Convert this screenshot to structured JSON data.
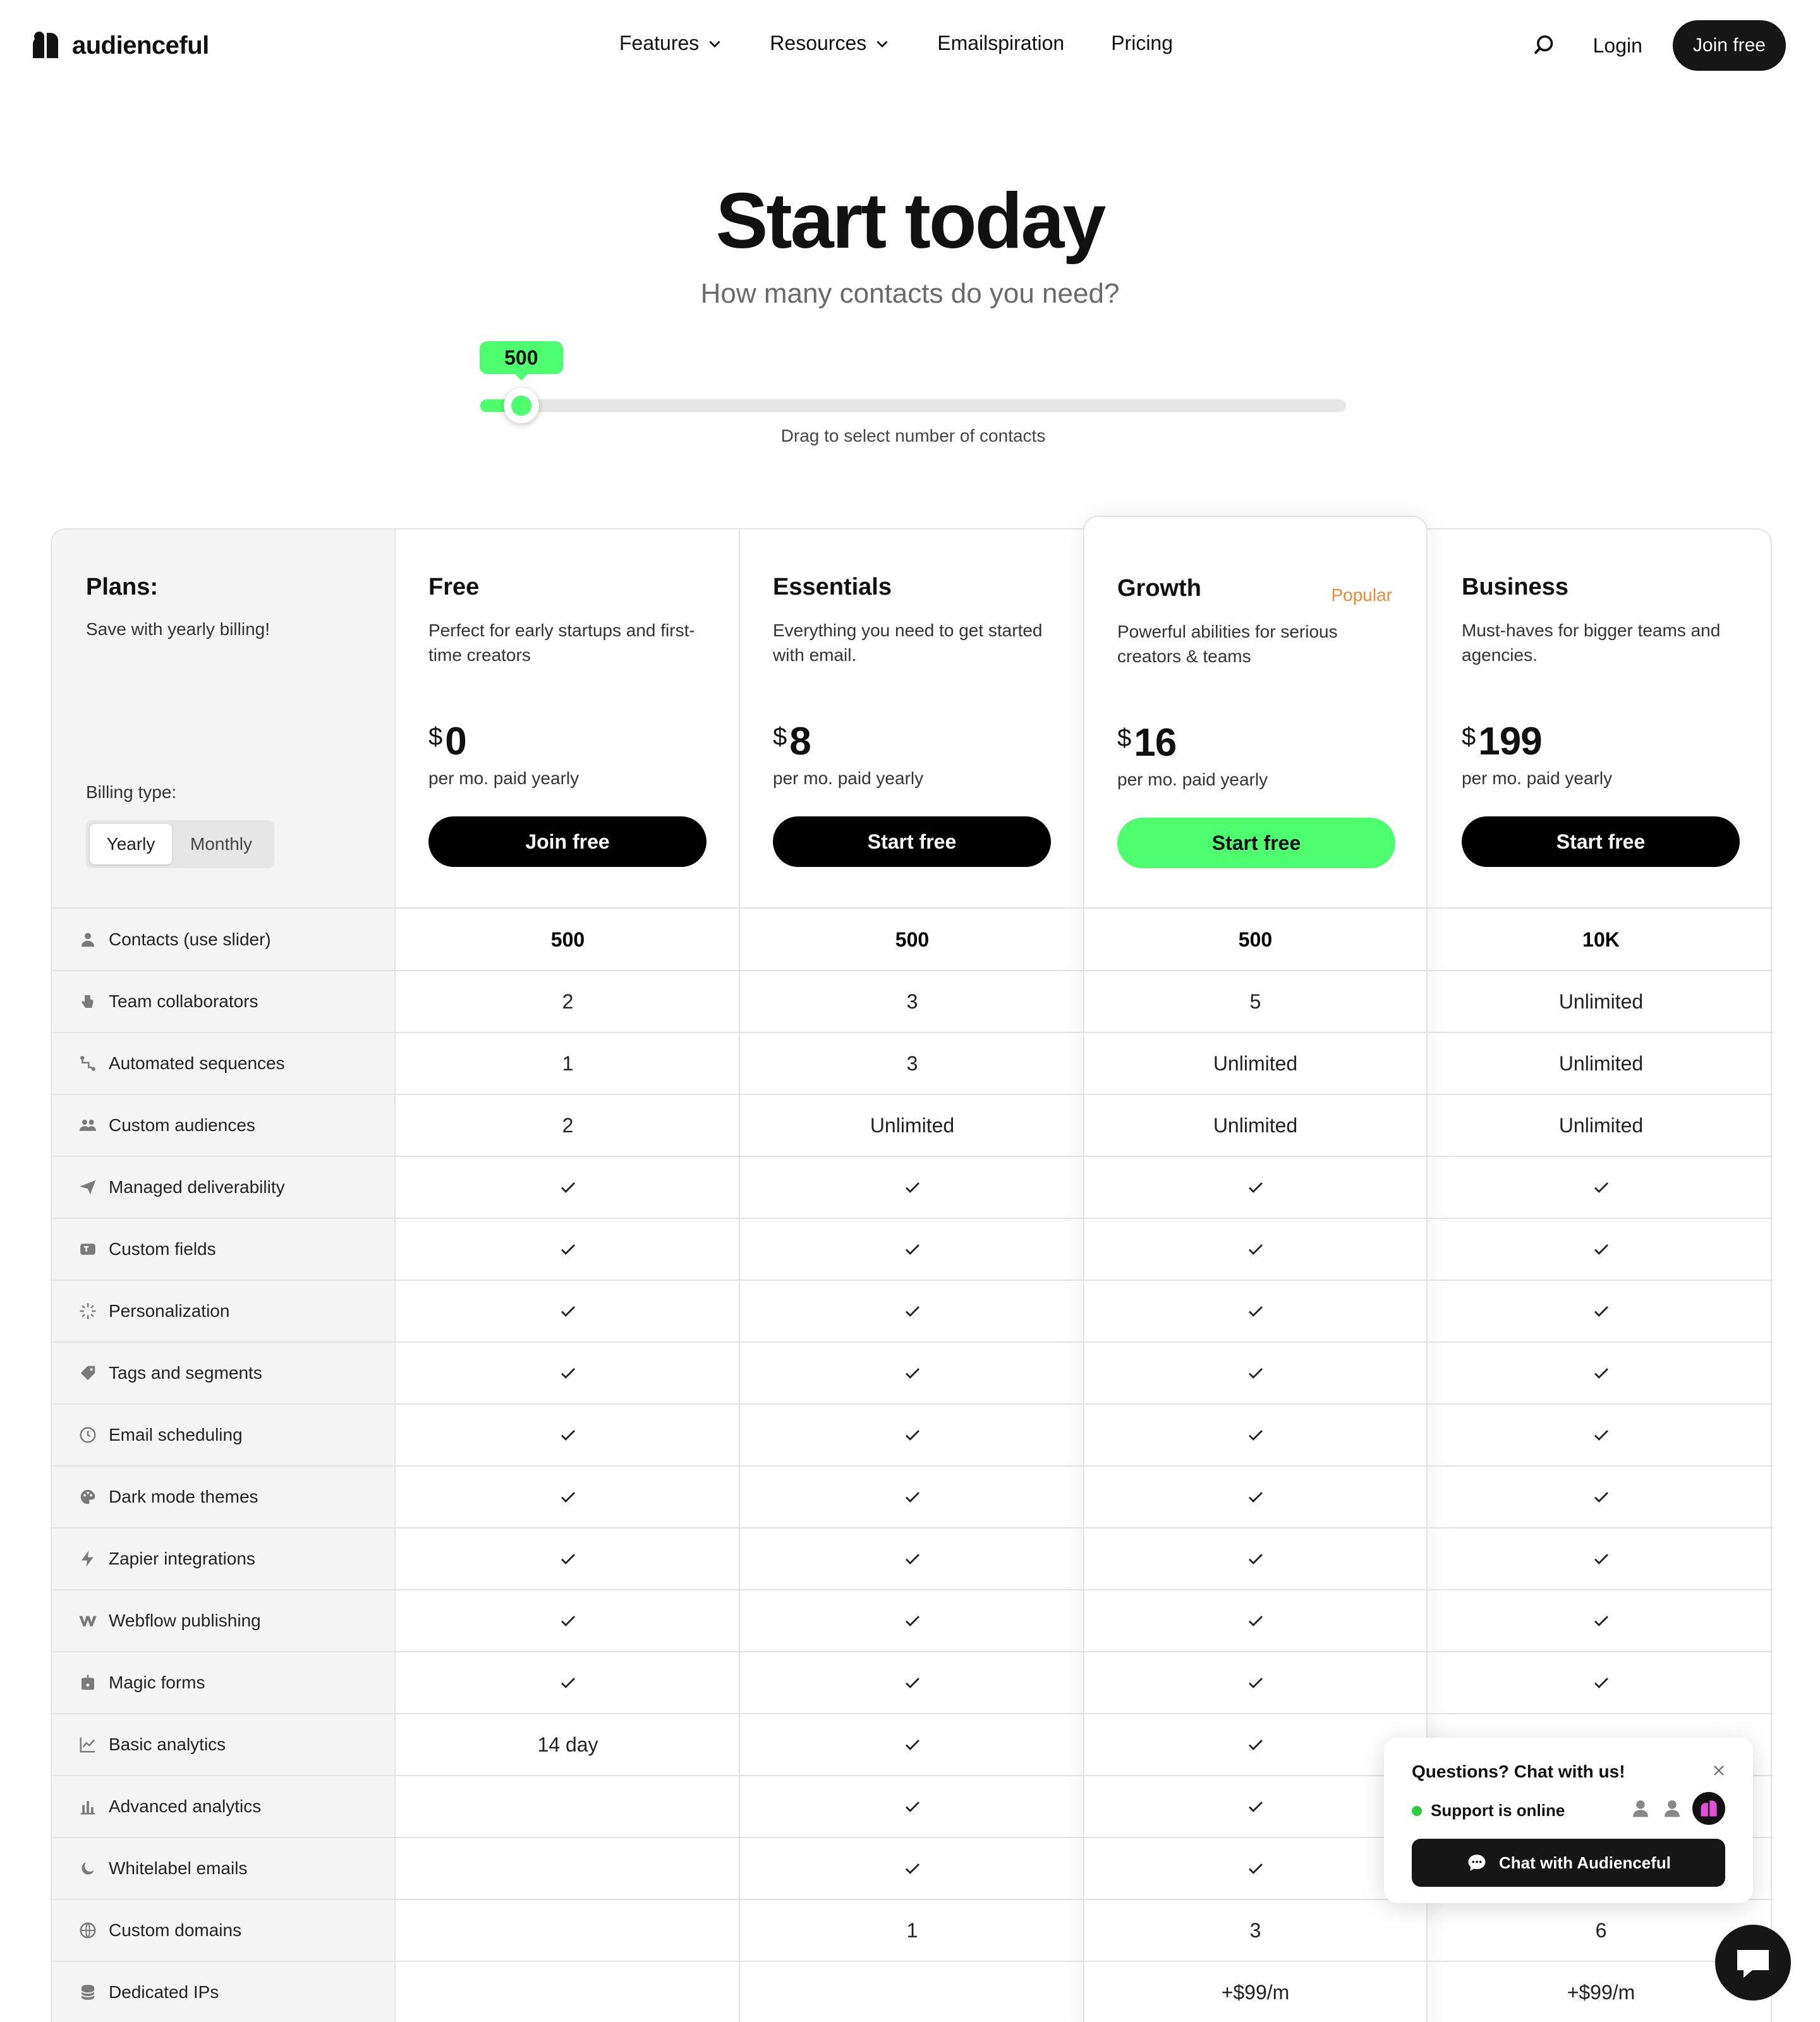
{
  "nav": {
    "logo_text": "audienceful",
    "links": [
      {
        "label": "Features",
        "dropdown": true
      },
      {
        "label": "Resources",
        "dropdown": true
      },
      {
        "label": "Emailspiration",
        "dropdown": false
      },
      {
        "label": "Pricing",
        "dropdown": false
      }
    ],
    "login": "Login",
    "join": "Join free"
  },
  "hero": {
    "title": "Start today",
    "subtitle": "How many contacts do you need?"
  },
  "slider": {
    "value_label": "500",
    "fraction": 0.04,
    "hint": "Drag to select number of contacts"
  },
  "plans_header": {
    "title": "Plans:",
    "subtitle": "Save with yearly billing!",
    "billing_label": "Billing type:",
    "billing_options": [
      "Yearly",
      "Monthly"
    ],
    "billing_selected": "Yearly"
  },
  "plans": [
    {
      "name": "Free",
      "badge": "",
      "desc": "Perfect for early startups and first-time creators",
      "currency": "$",
      "price": "0",
      "period": "per mo. paid yearly",
      "cta": "Join free"
    },
    {
      "name": "Essentials",
      "badge": "",
      "desc": "Everything you need to get started with email.",
      "currency": "$",
      "price": "8",
      "period": "per mo. paid yearly",
      "cta": "Start free"
    },
    {
      "name": "Growth",
      "badge": "Popular",
      "desc": "Powerful abilities for serious creators & teams",
      "currency": "$",
      "price": "16",
      "period": "per mo. paid yearly",
      "cta": "Start free"
    },
    {
      "name": "Business",
      "badge": "",
      "desc": "Must-haves for bigger teams and agencies.",
      "currency": "$",
      "price": "199",
      "period": "per mo. paid yearly",
      "cta": "Start free"
    }
  ],
  "features": [
    {
      "label": "Contacts (use slider)",
      "icon": "person-icon",
      "bold": true,
      "values": [
        "500",
        "500",
        "500",
        "10K"
      ]
    },
    {
      "label": "Team collaborators",
      "icon": "hand-icon",
      "values": [
        "2",
        "3",
        "5",
        "Unlimited"
      ]
    },
    {
      "label": "Automated sequences",
      "icon": "flow-icon",
      "values": [
        "1",
        "3",
        "Unlimited",
        "Unlimited"
      ]
    },
    {
      "label": "Custom audiences",
      "icon": "people-icon",
      "values": [
        "2",
        "Unlimited",
        "Unlimited",
        "Unlimited"
      ]
    },
    {
      "label": "Managed deliverability",
      "icon": "paper-plane-icon",
      "values": [
        "check",
        "check",
        "check",
        "check"
      ]
    },
    {
      "label": "Custom fields",
      "icon": "field-icon",
      "values": [
        "check",
        "check",
        "check",
        "check"
      ]
    },
    {
      "label": "Personalization",
      "icon": "sparkle-icon",
      "values": [
        "check",
        "check",
        "check",
        "check"
      ]
    },
    {
      "label": "Tags and segments",
      "icon": "tag-icon",
      "values": [
        "check",
        "check",
        "check",
        "check"
      ]
    },
    {
      "label": "Email scheduling",
      "icon": "clock-icon",
      "values": [
        "check",
        "check",
        "check",
        "check"
      ]
    },
    {
      "label": "Dark mode themes",
      "icon": "palette-icon",
      "values": [
        "check",
        "check",
        "check",
        "check"
      ]
    },
    {
      "label": "Zapier integrations",
      "icon": "bolt-icon",
      "values": [
        "check",
        "check",
        "check",
        "check"
      ]
    },
    {
      "label": "Webflow publishing",
      "icon": "webflow-icon",
      "values": [
        "check",
        "check",
        "check",
        "check"
      ]
    },
    {
      "label": "Magic forms",
      "icon": "form-icon",
      "values": [
        "check",
        "check",
        "check",
        "check"
      ]
    },
    {
      "label": "Basic analytics",
      "icon": "line-chart-icon",
      "values": [
        "14 day",
        "check",
        "check",
        ""
      ]
    },
    {
      "label": "Advanced analytics",
      "icon": "bar-chart-icon",
      "values": [
        "",
        "check",
        "check",
        ""
      ]
    },
    {
      "label": "Whitelabel emails",
      "icon": "moon-icon",
      "values": [
        "",
        "check",
        "check",
        ""
      ]
    },
    {
      "label": "Custom domains",
      "icon": "globe-icon",
      "values": [
        "",
        "1",
        "3",
        "6"
      ]
    },
    {
      "label": "Dedicated IPs",
      "icon": "database-icon",
      "values": [
        "",
        "",
        "+$99/m",
        "+$99/m"
      ]
    }
  ],
  "chat": {
    "title": "Questions? Chat with us!",
    "status": "Support is online",
    "button": "Chat with Audienceful"
  },
  "colors": {
    "accent": "#4dff6e",
    "badge": "#f08a3b",
    "dark": "#161616"
  }
}
